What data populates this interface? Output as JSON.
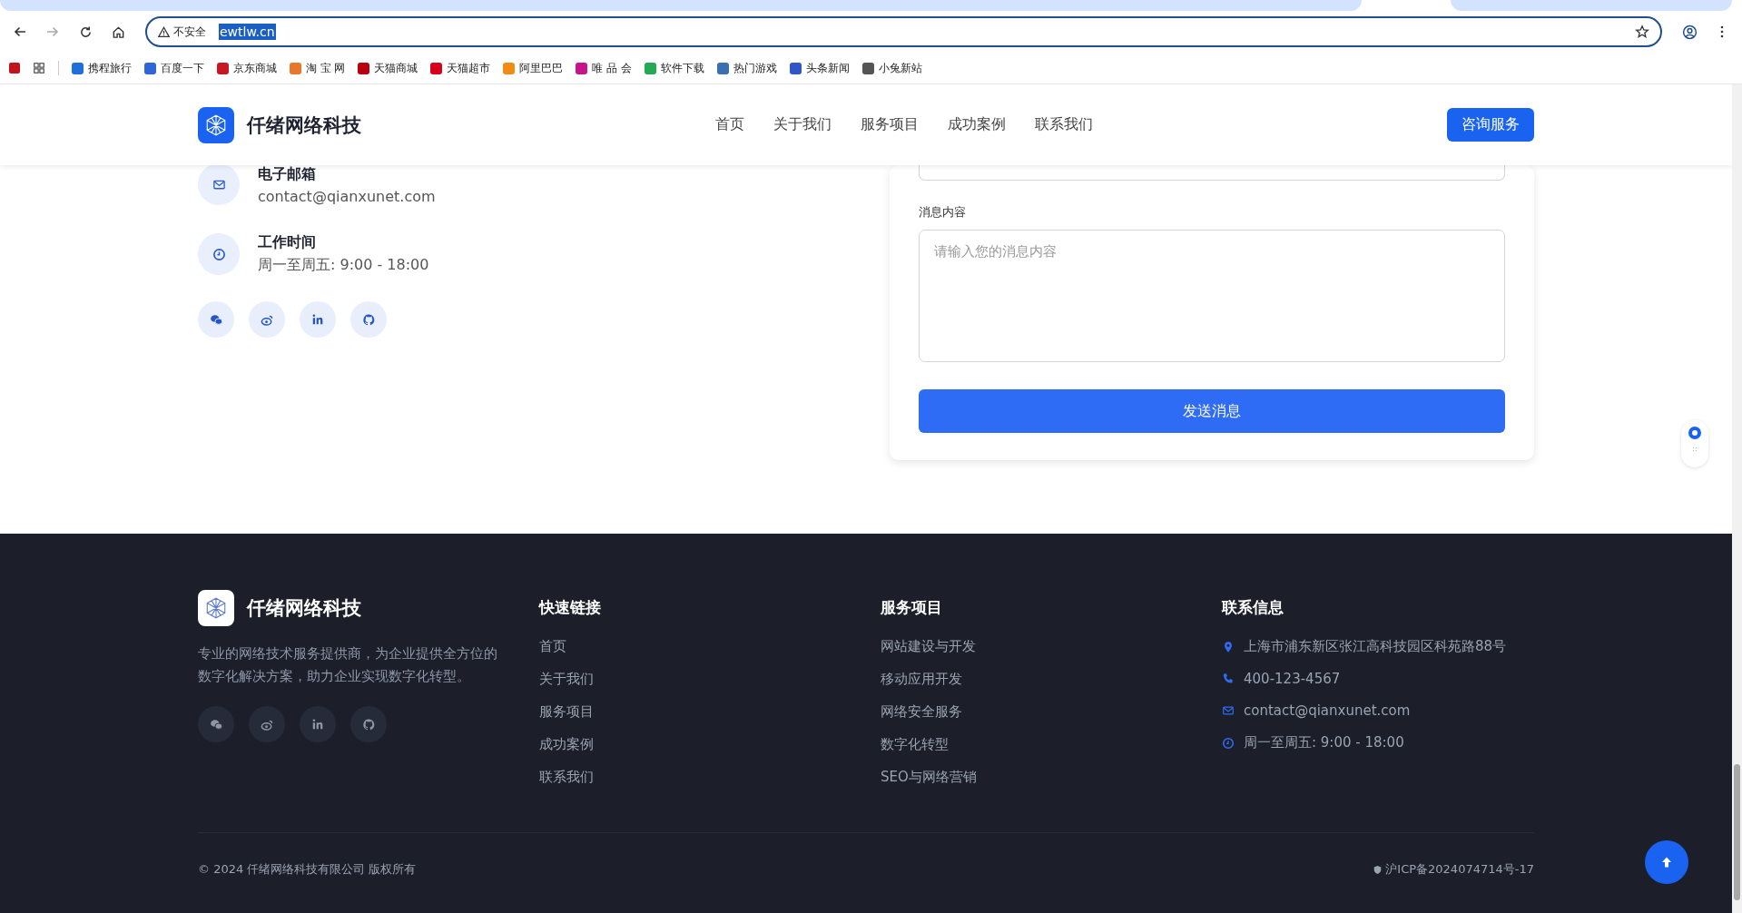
{
  "browser": {
    "security_label": "不安全",
    "url": "ewtlw.cn",
    "url_selected": true,
    "bookmarks": [
      {
        "label": "携程旅行",
        "color": "#1e6fd9"
      },
      {
        "label": "百度一下",
        "color": "#3065d8"
      },
      {
        "label": "京东商城",
        "color": "#c81623"
      },
      {
        "label": "淘 宝 网",
        "color": "#e8762b"
      },
      {
        "label": "天猫商城",
        "color": "#b8000f"
      },
      {
        "label": "天猫超市",
        "color": "#d6001c"
      },
      {
        "label": "阿里巴巴",
        "color": "#f08c14"
      },
      {
        "label": "唯 品 会",
        "color": "#c5148c"
      },
      {
        "label": "软件下载",
        "color": "#22aa55"
      },
      {
        "label": "热门游戏",
        "color": "#3a6fb0"
      },
      {
        "label": "头条新闻",
        "color": "#2f55c8"
      },
      {
        "label": "小兔新站",
        "color": "#555555"
      }
    ]
  },
  "header": {
    "brand": "仟绪网络科技",
    "nav": [
      {
        "label": "首页",
        "selected": false
      },
      {
        "label": "关于我们",
        "selected": false
      },
      {
        "label": "服务项目",
        "selected": false
      },
      {
        "label": "成功案例",
        "selected": false
      },
      {
        "label": "联系我们",
        "selected": false
      }
    ],
    "cta": "咨询服务"
  },
  "contact": {
    "items": [
      {
        "kind": "email",
        "title": "电子邮箱",
        "value": "contact@qianxunet.com"
      },
      {
        "kind": "clock",
        "title": "工作时间",
        "value": "周一至周五: 9:00 - 18:00"
      }
    ]
  },
  "form": {
    "message_label": "消息内容",
    "message_placeholder": "请输入您的消息内容",
    "submit": "发送消息"
  },
  "footer": {
    "brand": "仟绪网络科技",
    "description": "专业的网络技术服务提供商，为企业提供全方位的数字化解决方案，助力企业实现数字化转型。",
    "columns": [
      {
        "title": "快速链接",
        "links": [
          "首页",
          "关于我们",
          "服务项目",
          "成功案例",
          "联系我们"
        ]
      },
      {
        "title": "服务项目",
        "links": [
          "网站建设与开发",
          "移动应用开发",
          "网络安全服务",
          "数字化转型",
          "SEO与网络营销"
        ]
      }
    ],
    "contact_title": "联系信息",
    "contact": [
      {
        "kind": "pin",
        "text": "上海市浦东新区张江高科技园区科苑路88号"
      },
      {
        "kind": "phone",
        "text": "400-123-4567"
      },
      {
        "kind": "email",
        "text": "contact@qianxunet.com"
      },
      {
        "kind": "clock",
        "text": "周一至周五: 9:00 - 18:00"
      }
    ],
    "copyright": "© 2024 仟绪网络科技有限公司 版权所有",
    "icp": "沪ICP备2024074714号-17"
  }
}
